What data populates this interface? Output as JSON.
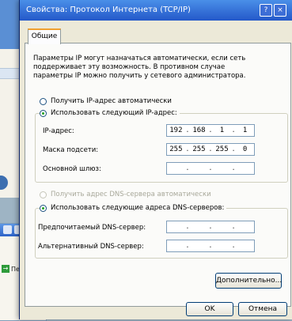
{
  "background_window": {
    "go_label": "Переход"
  },
  "dialog": {
    "title": "Свойства: Протокол Интернета (TCP/IP)",
    "help_glyph": "?",
    "close_glyph": "×",
    "tab": "Общие",
    "description": "Параметры IP могут назначаться автоматически, если сеть поддерживает эту возможность. В противном случае параметры IP можно получить у сетевого администратора.",
    "ip_section": {
      "auto_label": "Получить IP-адрес автоматически",
      "manual_label": "Использовать следующий IP-адрес:",
      "selected": "manual",
      "fields": [
        {
          "label": "IP-адрес:",
          "octets": [
            "192",
            "168",
            "1",
            "1"
          ]
        },
        {
          "label": "Маска подсети:",
          "octets": [
            "255",
            "255",
            "255",
            "0"
          ]
        },
        {
          "label": "Основной шлюз:",
          "octets": [
            "",
            "",
            "",
            ""
          ]
        }
      ]
    },
    "dns_section": {
      "auto_label": "Получить адрес DNS-сервера автоматически",
      "manual_label": "Использовать следующие адреса DNS-серверов:",
      "selected": "manual",
      "fields": [
        {
          "label": "Предпочитаемый DNS-сервер:",
          "octets": [
            "",
            "",
            "",
            ""
          ]
        },
        {
          "label": "Альтернативный DNS-сервер:",
          "octets": [
            "",
            "",
            "",
            ""
          ]
        }
      ]
    },
    "advanced_button": "Дополнительно...",
    "ok_button": "OK",
    "cancel_button": "Отмена"
  },
  "colors": {
    "titlebar": "#2458c9",
    "dialog_bg": "#ece9d8",
    "selected_radio": "#21a121"
  }
}
